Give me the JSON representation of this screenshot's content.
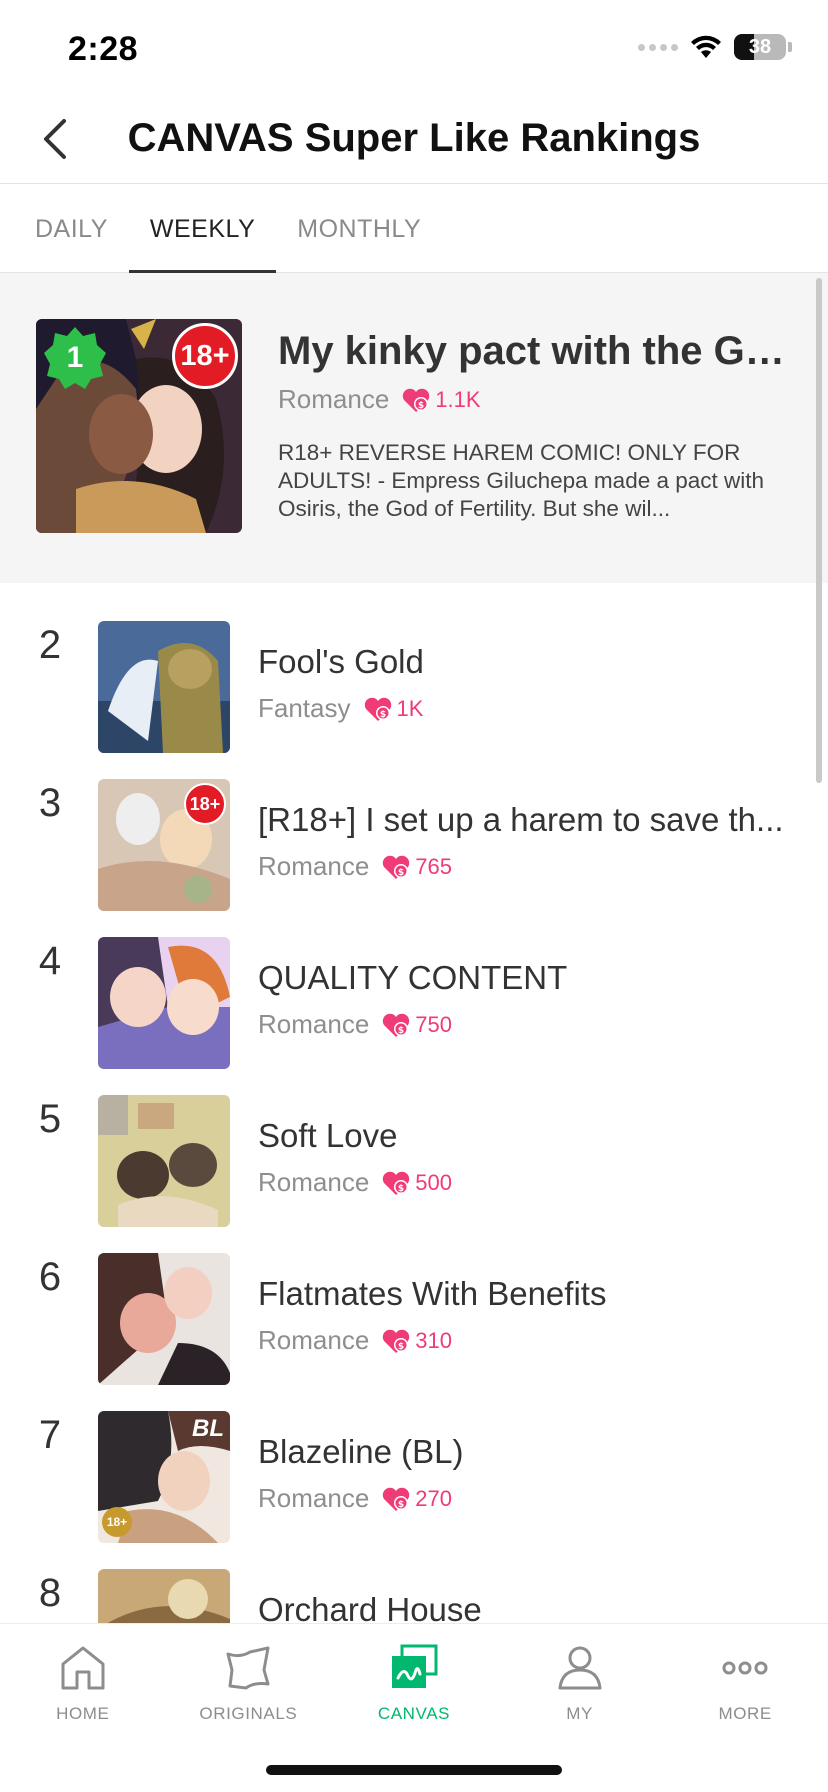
{
  "status_bar": {
    "time": "2:28",
    "battery": "38",
    "battery_level": 0.38
  },
  "header": {
    "title": "CANVAS Super Like Rankings",
    "back_icon": "chevron-left-icon"
  },
  "tabs": [
    {
      "label": "DAILY",
      "active": false
    },
    {
      "label": "WEEKLY",
      "active": true
    },
    {
      "label": "MONTHLY",
      "active": false
    }
  ],
  "top_item": {
    "rank": "1",
    "badge": "18+",
    "title": "My kinky pact with the Go...",
    "genre": "Romance",
    "likes": "1.1K",
    "description": "R18+ REVERSE HAREM COMIC! ONLY FOR ADULTS! - Empress Giluchepa made a pact with Osiris, the God of Fertility. But she wil..."
  },
  "list": [
    {
      "rank": "2",
      "title": "Fool's Gold",
      "genre": "Fantasy",
      "likes": "1K"
    },
    {
      "rank": "3",
      "title": "[R18+] I set up a harem to save th...",
      "genre": "Romance",
      "likes": "765",
      "badge": "18+"
    },
    {
      "rank": "4",
      "title": "QUALITY CONTENT",
      "genre": "Romance",
      "likes": "750"
    },
    {
      "rank": "5",
      "title": "Soft Love",
      "genre": "Romance",
      "likes": "500"
    },
    {
      "rank": "6",
      "title": "Flatmates With Benefits",
      "genre": "Romance",
      "likes": "310"
    },
    {
      "rank": "7",
      "title": "Blazeline (BL)",
      "genre": "Romance",
      "likes": "270",
      "thumb_tag": "BL",
      "small_badge": "18+"
    },
    {
      "rank": "8",
      "title": "Orchard House",
      "genre": "",
      "likes": ""
    }
  ],
  "bottom_nav": [
    {
      "label": "HOME",
      "icon": "home-icon",
      "active": false
    },
    {
      "label": "ORIGINALS",
      "icon": "originals-icon",
      "active": false
    },
    {
      "label": "CANVAS",
      "icon": "canvas-icon",
      "active": true
    },
    {
      "label": "MY",
      "icon": "profile-icon",
      "active": false
    },
    {
      "label": "MORE",
      "icon": "more-icon",
      "active": false
    }
  ],
  "colors": {
    "accent": "#00b86f",
    "like": "#ef3b76",
    "adult_badge": "#e21b24",
    "rank_badge": "#2dbf4a"
  }
}
